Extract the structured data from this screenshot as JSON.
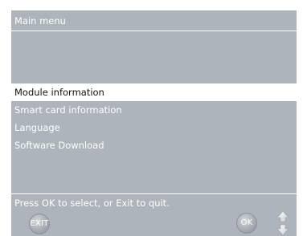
{
  "window": {
    "title": "Main menu"
  },
  "menu": {
    "items": [
      {
        "label": "Module information",
        "selected": true
      },
      {
        "label": "Smart card information",
        "selected": false
      },
      {
        "label": "Language",
        "selected": false
      },
      {
        "label": "Software Download",
        "selected": false
      }
    ]
  },
  "footer": {
    "hint": "Press OK to select, or Exit to quit.",
    "exit_label": "EXIT",
    "ok_label": "OK",
    "nav_icon": "up-down-arrows-icon"
  },
  "colors": {
    "panel_background": "#aeb4bb",
    "text": "#ffffff",
    "selection_background": "#ffffff",
    "selection_text": "#111111"
  }
}
